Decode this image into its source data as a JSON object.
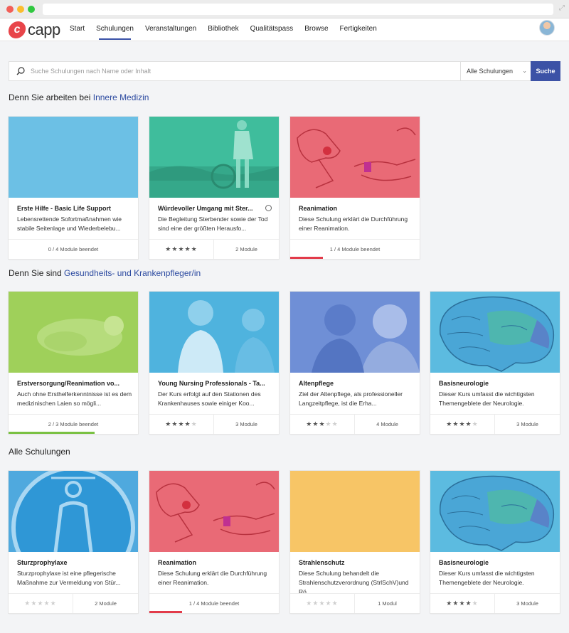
{
  "app": {
    "logo_letter": "c",
    "logo_text": "capp"
  },
  "nav": [
    "Start",
    "Schulungen",
    "Veranstaltungen",
    "Bibliothek",
    "Qualitätspass",
    "Browse",
    "Fertigkeiten"
  ],
  "search": {
    "placeholder": "Suche Schulungen nach Name oder Inhalt",
    "filter": "Alle Schulungen",
    "button": "Suche"
  },
  "sections": {
    "s1": {
      "prefix": "Denn Sie arbeiten bei ",
      "highlight": "Innere Medizin"
    },
    "s2": {
      "prefix": "Denn Sie sind ",
      "highlight": "Gesundheits- und Krankenpfleger/in"
    },
    "s3": {
      "prefix": "Alle Schulungen",
      "highlight": ""
    }
  },
  "colors": {
    "blue": "#6cc0e5",
    "teal": "#3fbd9c",
    "red": "#e96a76",
    "green": "#9fd05a",
    "nurse": "#4fb3de",
    "elder": "#6f8fd6",
    "brain": "#5cbbe0",
    "yellow": "#f7c566",
    "accent": "#3c52a6",
    "progress_red": "#e23b4a",
    "progress_green": "#7ac143"
  },
  "cards": {
    "c1": {
      "title": "Erste Hilfe - Basic Life Support",
      "desc": "Lebensrettende Sofortmaßnahmen wie stabile Seitenlage und Wiederbelebu...",
      "foot": "0 / 4 Module beendet"
    },
    "c2": {
      "title": "Würdevoller Umgang mit Ster...",
      "desc": "Die Begleitung Sterbender sowie der Tod sind eine der größten Herausfo...",
      "rating": 5,
      "modules": "2 Module"
    },
    "c3": {
      "title": "Reanimation",
      "desc": "Diese Schulung erklärt die Durchführung einer Reanimation.",
      "foot": "1 / 4 Module beendet",
      "progress": 0.25
    },
    "c4": {
      "title": "Erstversorgung/Reanimation vo...",
      "desc": "Auch ohne Ersthelferkenntnisse ist es dem medizinischen Laien so mögli...",
      "foot": "2 / 3 Module beendet",
      "progress": 0.667
    },
    "c5": {
      "title": "Young Nursing Professionals - Ta...",
      "desc": "Der Kurs erfolgt auf den Stationen des Krankenhauses sowie einiger Koo...",
      "rating": 4,
      "modules": "3 Module"
    },
    "c6": {
      "title": "Altenpflege",
      "desc": "Ziel der Altenpflege, als professioneller Langzeitpflege, ist die Erha...",
      "rating": 3,
      "modules": "4 Module"
    },
    "c7": {
      "title": "Basisneurologie",
      "desc": "Dieser Kurs umfasst die wichtigsten Themengeblete der Neurologie.",
      "rating": 4,
      "modules": "3 Module"
    },
    "c8": {
      "title": "Sturzprophylaxe",
      "desc": "Sturzprophylaxe ist eine pflegerische Maßnahme zur Vermeldung von Stür...",
      "rating": 0,
      "modules": "2 Module"
    },
    "c9": {
      "title": "Reanimation",
      "desc": "Diese Schulung erklärt die Durchführung einer Reanimation.",
      "foot": "1 / 4 Module beendet",
      "progress": 0.25
    },
    "c10": {
      "title": "Strahlenschutz",
      "desc": "Diese Schulung behandelt die Strahlenschutzverordnung (StrlSchV)und Rö...",
      "rating": 0,
      "modules": "1 Modul"
    },
    "c11": {
      "title": "Basisneurologie",
      "desc": "Dieser Kurs umfasst die wichtigsten Themengeblete der Neurologie.",
      "rating": 4,
      "modules": "3 Module"
    }
  }
}
